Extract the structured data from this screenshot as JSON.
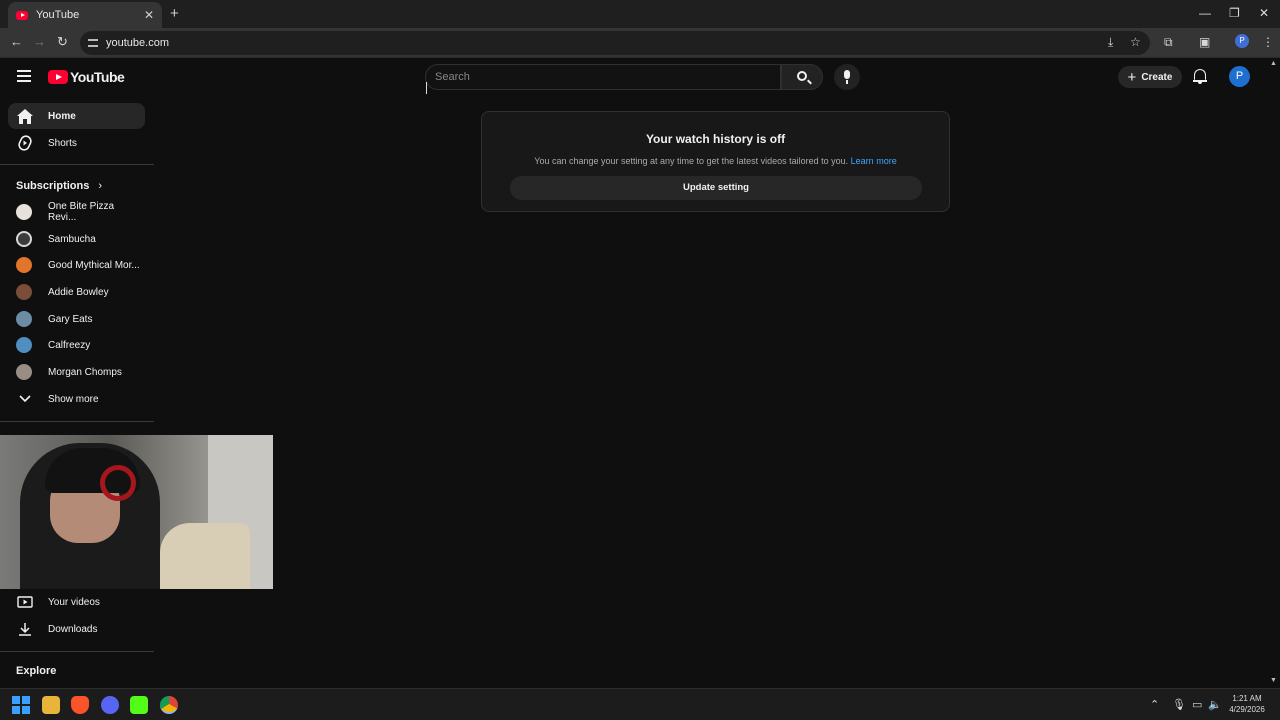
{
  "browser": {
    "tab_title": "YouTube",
    "url": "youtube.com",
    "profile_initial": "P"
  },
  "header": {
    "logo_text": "YouTube",
    "search_placeholder": "Search",
    "create_label": "Create",
    "avatar_initial": "P"
  },
  "sidebar": {
    "home_label": "Home",
    "shorts_label": "Shorts",
    "subscriptions_heading": "Subscriptions",
    "subscriptions": [
      {
        "name": "One Bite Pizza Revi...",
        "color": "#e7e2dc"
      },
      {
        "name": "Sambucha",
        "color": "#3b3b3b"
      },
      {
        "name": "Good Mythical Mor...",
        "color": "#e0752b"
      },
      {
        "name": "Addie Bowley",
        "color": "#7a4c3a"
      },
      {
        "name": "Gary Eats",
        "color": "#6b8ca3"
      },
      {
        "name": "Calfreezy",
        "color": "#4f8fc0"
      },
      {
        "name": "Morgan Chomps",
        "color": "#9a8d84"
      }
    ],
    "show_more_label": "Show more",
    "your_videos_label": "Your videos",
    "downloads_label": "Downloads",
    "explore_heading": "Explore"
  },
  "history_card": {
    "title": "Your watch history is off",
    "message": "You can change your setting at any time to get the latest videos tailored to you.",
    "learn_more": "Learn more",
    "button_label": "Update setting"
  },
  "taskbar": {
    "time": "1:21 AM",
    "date": "4/29/2026"
  }
}
